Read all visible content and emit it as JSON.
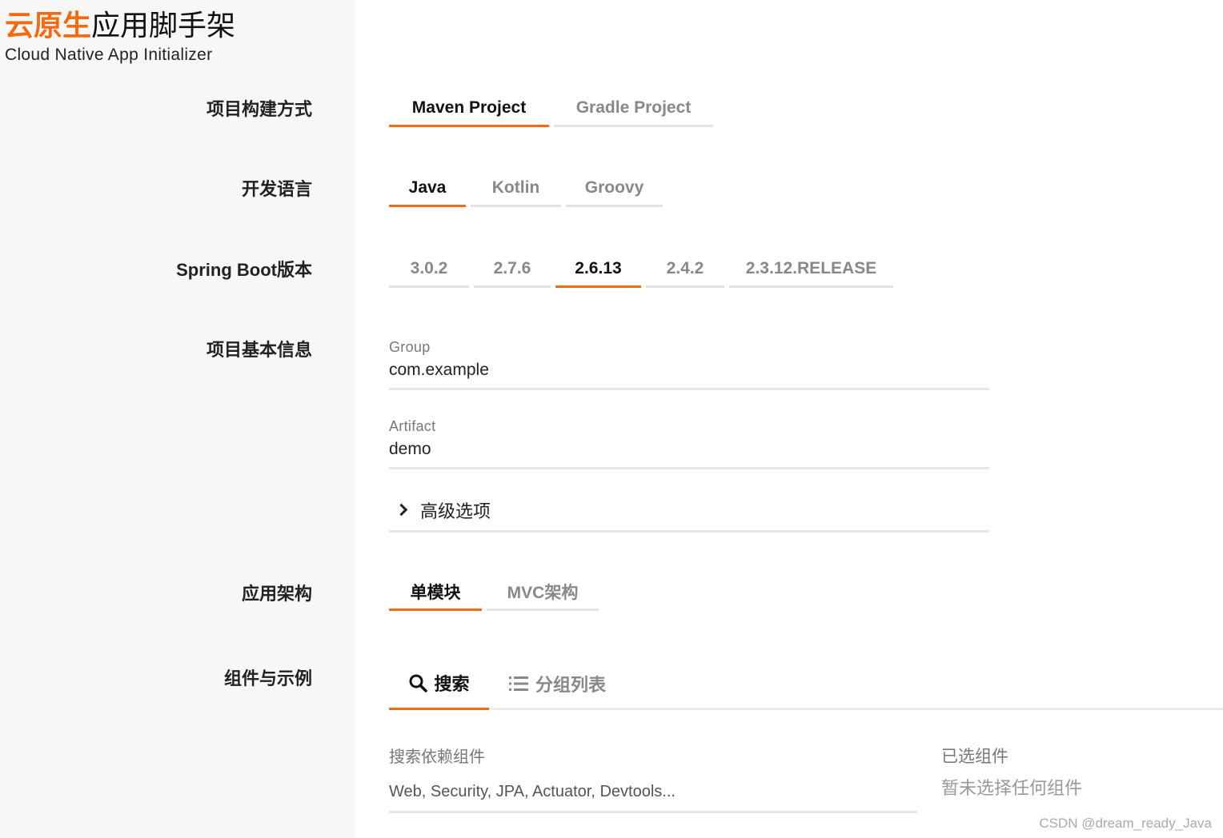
{
  "brand": {
    "title_accent": "云原生",
    "title_rest": "应用脚手架",
    "subtitle": "Cloud Native App Initializer"
  },
  "build": {
    "label": "项目构建方式",
    "options": [
      {
        "label": "Maven Project",
        "active": true
      },
      {
        "label": "Gradle Project",
        "active": false
      }
    ]
  },
  "language": {
    "label": "开发语言",
    "options": [
      {
        "label": "Java",
        "active": true
      },
      {
        "label": "Kotlin",
        "active": false
      },
      {
        "label": "Groovy",
        "active": false
      }
    ]
  },
  "boot": {
    "label": "Spring Boot版本",
    "options": [
      {
        "label": "3.0.2",
        "active": false
      },
      {
        "label": "2.7.6",
        "active": false
      },
      {
        "label": "2.6.13",
        "active": true
      },
      {
        "label": "2.4.2",
        "active": false
      },
      {
        "label": "2.3.12.RELEASE",
        "active": false
      }
    ]
  },
  "info": {
    "label": "项目基本信息",
    "group_label": "Group",
    "group_value": "com.example",
    "artifact_label": "Artifact",
    "artifact_value": "demo",
    "advanced_label": "高级选项"
  },
  "arch": {
    "label": "应用架构",
    "options": [
      {
        "label": "单模块",
        "active": true
      },
      {
        "label": "MVC架构",
        "active": false
      }
    ]
  },
  "components": {
    "label": "组件与示例",
    "tab_search": "搜索",
    "tab_group": "分组列表",
    "search_label": "搜索依赖组件",
    "search_placeholder": "Web, Security, JPA, Actuator, Devtools...",
    "selected_title": "已选组件",
    "selected_empty": "暂未选择任何组件"
  },
  "watermark": "CSDN @dream_ready_Java",
  "colors": {
    "accent": "#f36a10",
    "sidebar_bg": "#f7f7f7",
    "tab_inactive_border": "#e3e3e3"
  }
}
